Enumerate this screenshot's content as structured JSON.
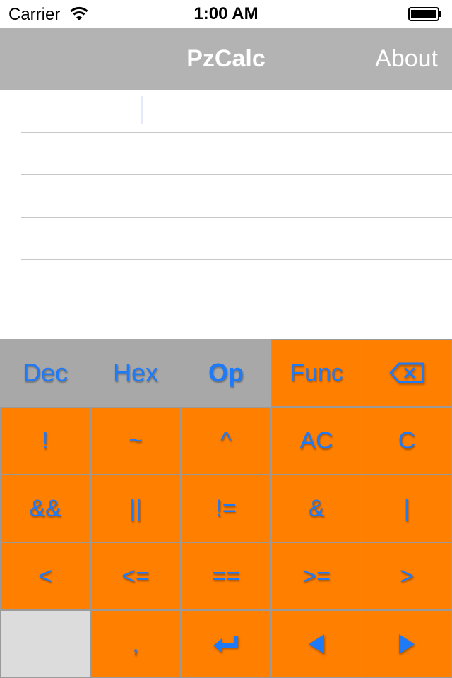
{
  "status_bar": {
    "carrier": "Carrier",
    "time": "1:00 AM"
  },
  "nav": {
    "title": "PzCalc",
    "about": "About"
  },
  "tabs": [
    {
      "label": "Dec"
    },
    {
      "label": "Hex"
    },
    {
      "label": "Op",
      "active": true
    }
  ],
  "keys": {
    "func": "Func",
    "backspace_icon": "backspace-icon",
    "r1": [
      "!",
      "~",
      "^",
      "AC",
      "C"
    ],
    "r2": [
      "&&",
      "||",
      "!=",
      "&",
      "|"
    ],
    "r3": [
      "<",
      "<=",
      "==",
      ">=",
      ">"
    ],
    "r4": {
      "comma": ",",
      "enter_icon": "return-arrow-icon",
      "left_icon": "left-arrow-icon",
      "right_icon": "right-arrow-icon"
    }
  },
  "colors": {
    "key_bg": "#ff7f00",
    "key_text": "#1f7af8",
    "nav_bg": "#b3b3b3",
    "tab_bg": "#a8a8a8"
  }
}
